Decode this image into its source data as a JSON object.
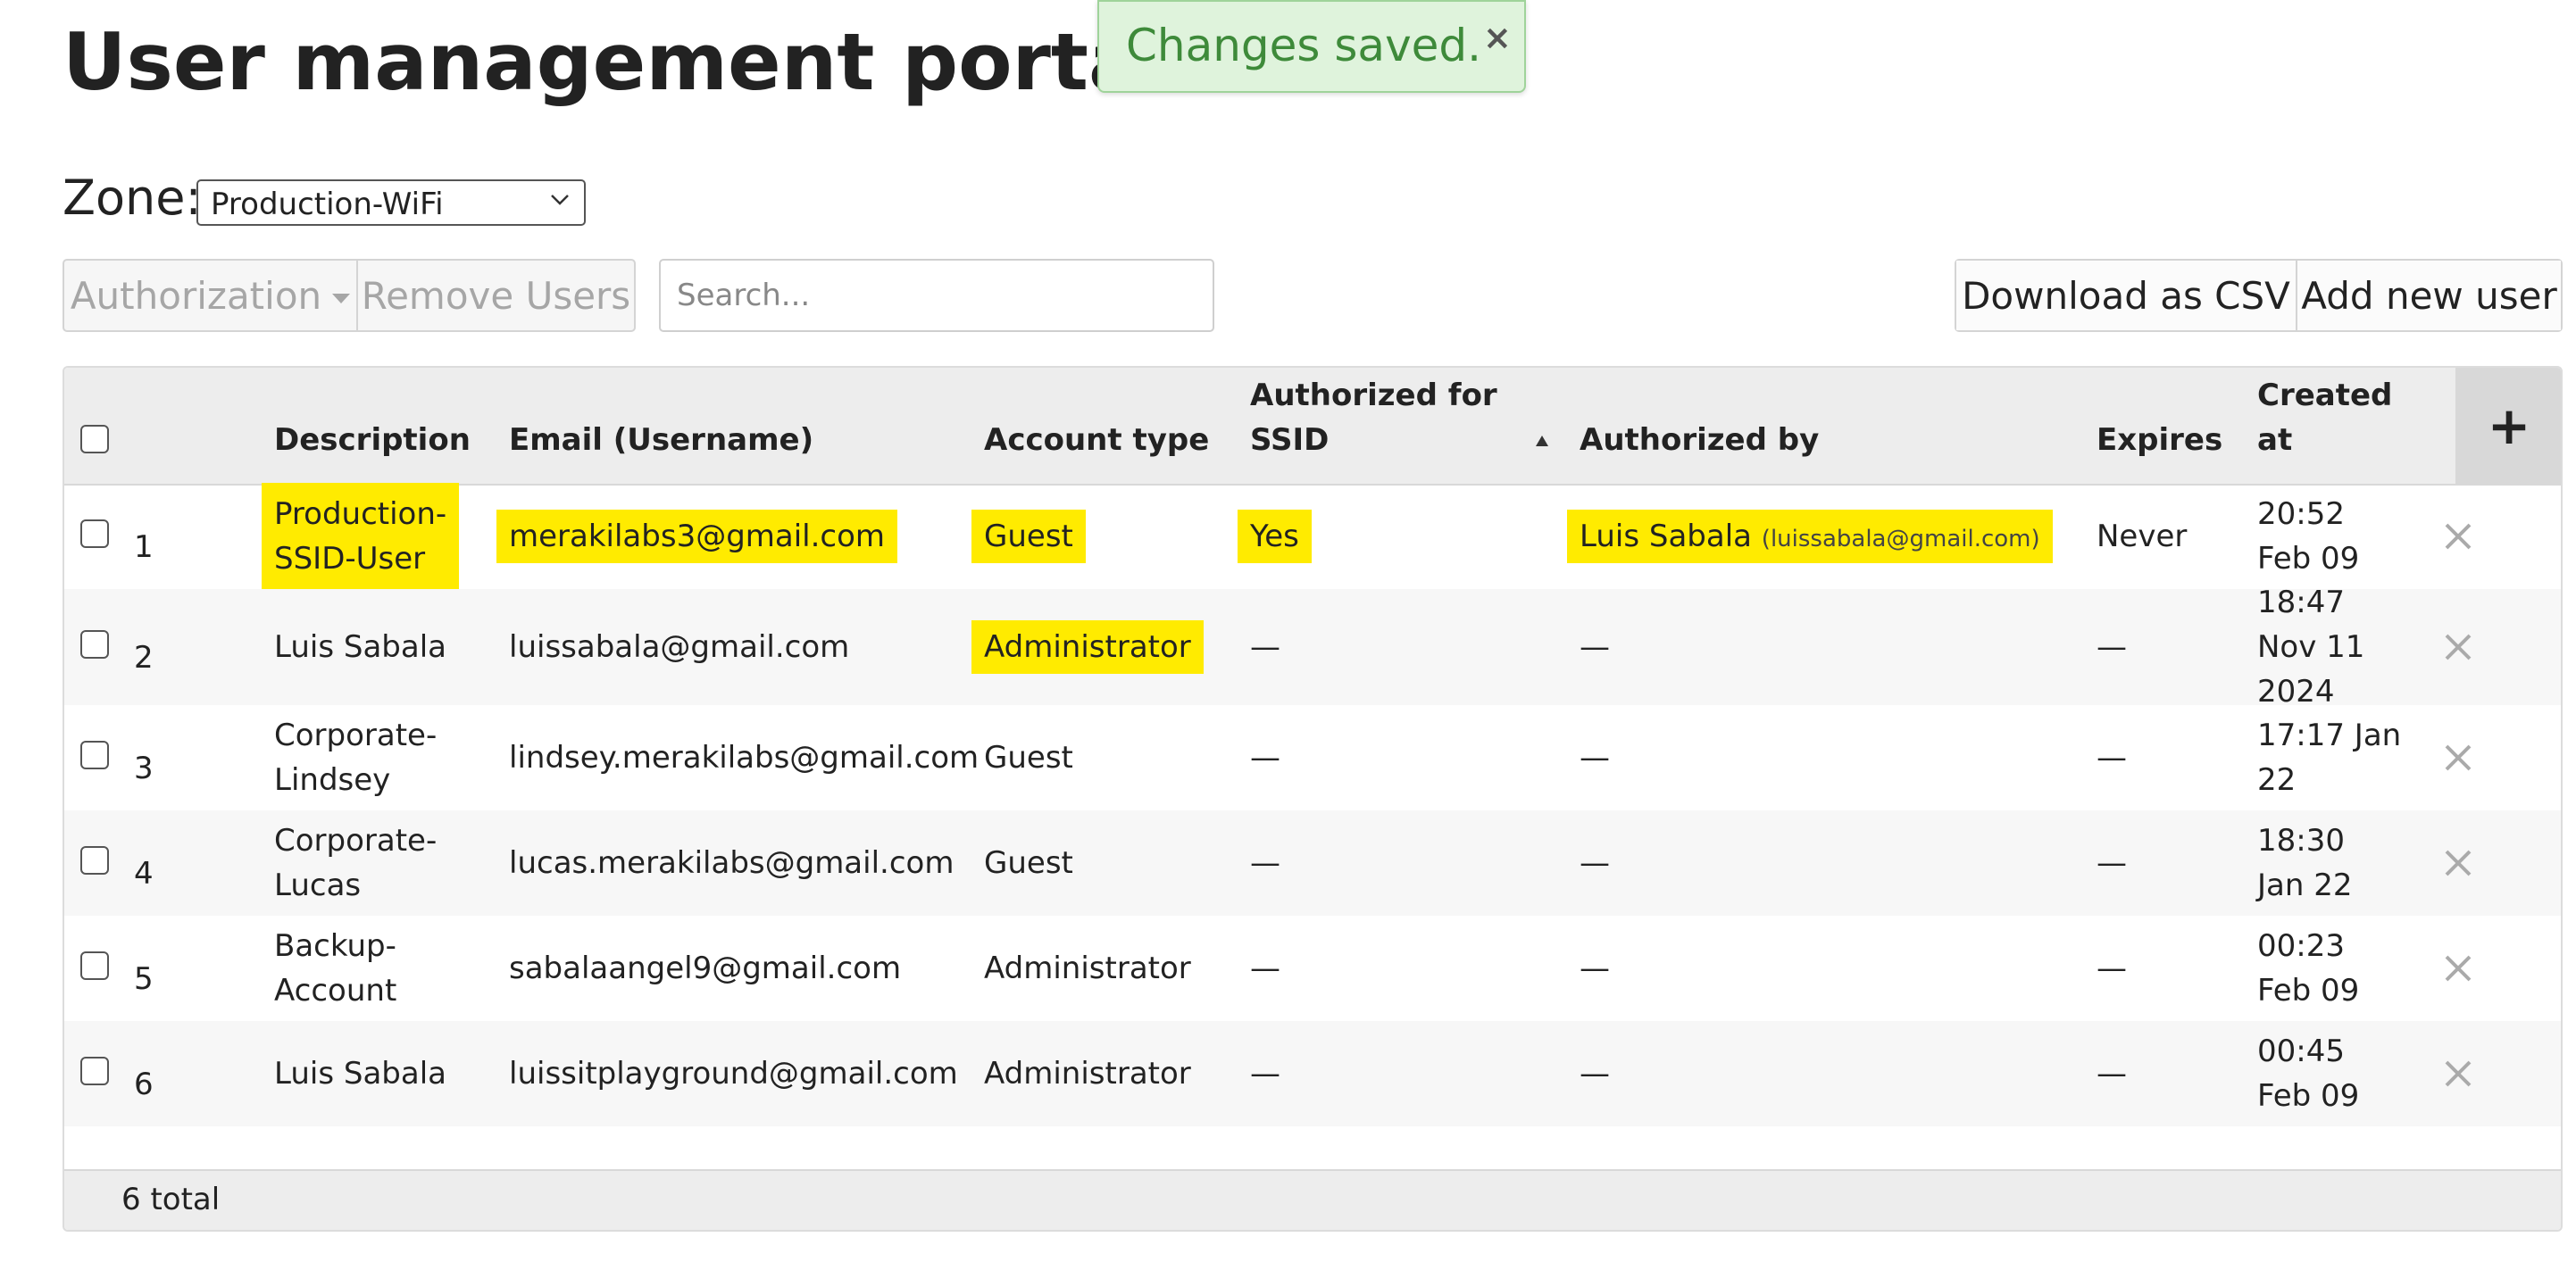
{
  "page": {
    "title": "User management portal"
  },
  "toast": {
    "message": "Changes saved.",
    "close": "×"
  },
  "zone": {
    "label": "Zone:",
    "selected": "Production-WiFi"
  },
  "toolbar": {
    "authorization": "Authorization",
    "remove_users": "Remove Users",
    "search_placeholder": "Search...",
    "download_csv": "Download as CSV",
    "add_user": "Add new user"
  },
  "table": {
    "headers": {
      "description": "Description",
      "email": "Email (Username)",
      "account_type": "Account type",
      "authorized_ssid_1": "Authorized for",
      "authorized_ssid_2": "SSID",
      "authorized_by": "Authorized by",
      "expires": "Expires",
      "created_1": "Created",
      "created_2": "at",
      "add": "+"
    },
    "rows": [
      {
        "num": "1",
        "description_1": "Production-",
        "description_2": "SSID-User",
        "email": "merakilabs3@gmail.com",
        "account_type": "Guest",
        "ssid": "Yes",
        "authorized_by": "Luis Sabala",
        "authorized_by_email": "(luissabala@gmail.com)",
        "expires": "Never",
        "created_1": "20:52",
        "created_2": "Feb 09",
        "created_3": ""
      },
      {
        "num": "2",
        "description_1": "Luis Sabala",
        "description_2": "",
        "email": "luissabala@gmail.com",
        "account_type": "Administrator",
        "ssid": "—",
        "authorized_by": "—",
        "authorized_by_email": "",
        "expires": "—",
        "created_1": "18:47",
        "created_2": "Nov 11",
        "created_3": "2024"
      },
      {
        "num": "3",
        "description_1": "Corporate-",
        "description_2": "Lindsey",
        "email": "lindsey.merakilabs@gmail.com",
        "account_type": "Guest",
        "ssid": "—",
        "authorized_by": "—",
        "authorized_by_email": "",
        "expires": "—",
        "created_1": "17:17   Jan",
        "created_2": "22",
        "created_3": ""
      },
      {
        "num": "4",
        "description_1": "Corporate-",
        "description_2": "Lucas",
        "email": "lucas.merakilabs@gmail.com",
        "account_type": "Guest",
        "ssid": "—",
        "authorized_by": "—",
        "authorized_by_email": "",
        "expires": "—",
        "created_1": "18:30",
        "created_2": "Jan 22",
        "created_3": ""
      },
      {
        "num": "5",
        "description_1": "Backup-",
        "description_2": "Account",
        "email": "sabalaangel9@gmail.com",
        "account_type": "Administrator",
        "ssid": "—",
        "authorized_by": "—",
        "authorized_by_email": "",
        "expires": "—",
        "created_1": "00:23",
        "created_2": "Feb 09",
        "created_3": ""
      },
      {
        "num": "6",
        "description_1": "Luis Sabala",
        "description_2": "",
        "email": "luissitplayground@gmail.com",
        "account_type": "Administrator",
        "ssid": "—",
        "authorized_by": "—",
        "authorized_by_email": "",
        "expires": "—",
        "created_1": "00:45",
        "created_2": "Feb 09",
        "created_3": ""
      }
    ],
    "footer": {
      "total": "6 total"
    }
  },
  "colors": {
    "highlight": "#ffeb00",
    "toast_bg": "#dff3dc",
    "toast_text": "#3e8a3a",
    "header_bg": "#ededed",
    "disabled_text": "#a6a6a6"
  },
  "icons": {
    "toast_close": "close-icon",
    "select": "chevron-down-icon",
    "row_delete": "delete-x-icon",
    "sort": "sort-asc-icon"
  }
}
